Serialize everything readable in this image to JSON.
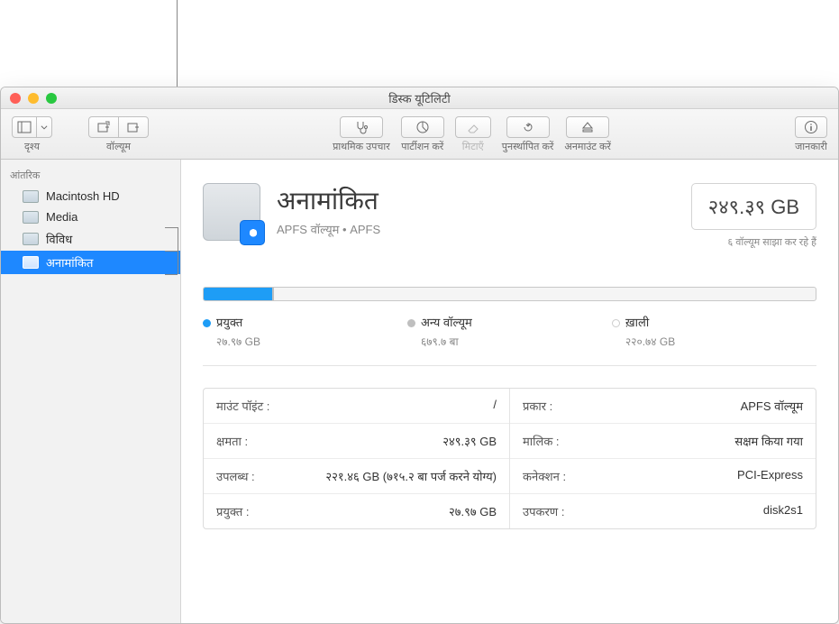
{
  "window": {
    "title": "डिस्क यूटिलिटी"
  },
  "toolbar": {
    "view": "दृश्य",
    "volume": "वॉल्यूम",
    "first_aid": "प्राथमिक उपचार",
    "partition": "पार्टीशन करें",
    "erase": "मिटाएँ",
    "restore": "पुनर्स्थापित करें",
    "unmount": "अनमाउंट करें",
    "info": "जानकारी"
  },
  "sidebar": {
    "heading": "आंतरिक",
    "items": [
      {
        "label": "Macintosh HD"
      },
      {
        "label": "Media"
      },
      {
        "label": "विविध"
      },
      {
        "label": "अनामांकित"
      }
    ]
  },
  "volume": {
    "name": "अनामांकित",
    "subtitle": "APFS वॉल्यूम • APFS",
    "size": "२४९.३९ GB",
    "sharing": "६ वॉल्यूम साझा कर रहे हैं"
  },
  "legend": {
    "used_label": "प्रयुक्त",
    "used_val": "२७.९७ GB",
    "other_label": "अन्य वॉल्यूम",
    "other_val": "६७९.७ बा",
    "free_label": "ख़ाली",
    "free_val": "२२०.७४ GB"
  },
  "details": {
    "mount_k": "माउंट पॉइंट :",
    "mount_v": "/",
    "capacity_k": "क्षमता :",
    "capacity_v": "२४९.३९ GB",
    "available_k": "उपलब्ध :",
    "available_v": "२२१.४६ GB (७१५.२ बा पर्ज करने योग्य)",
    "used_k": "प्रयुक्त :",
    "used_v": "२७.९७ GB",
    "type_k": "प्रकार :",
    "type_v": "APFS वॉल्यूम",
    "owner_k": "मालिक :",
    "owner_v": "सक्षम किया गया",
    "conn_k": "कनेक्शन :",
    "conn_v": "PCI-Express",
    "device_k": "उपकरण :",
    "device_v": "disk2s1"
  }
}
